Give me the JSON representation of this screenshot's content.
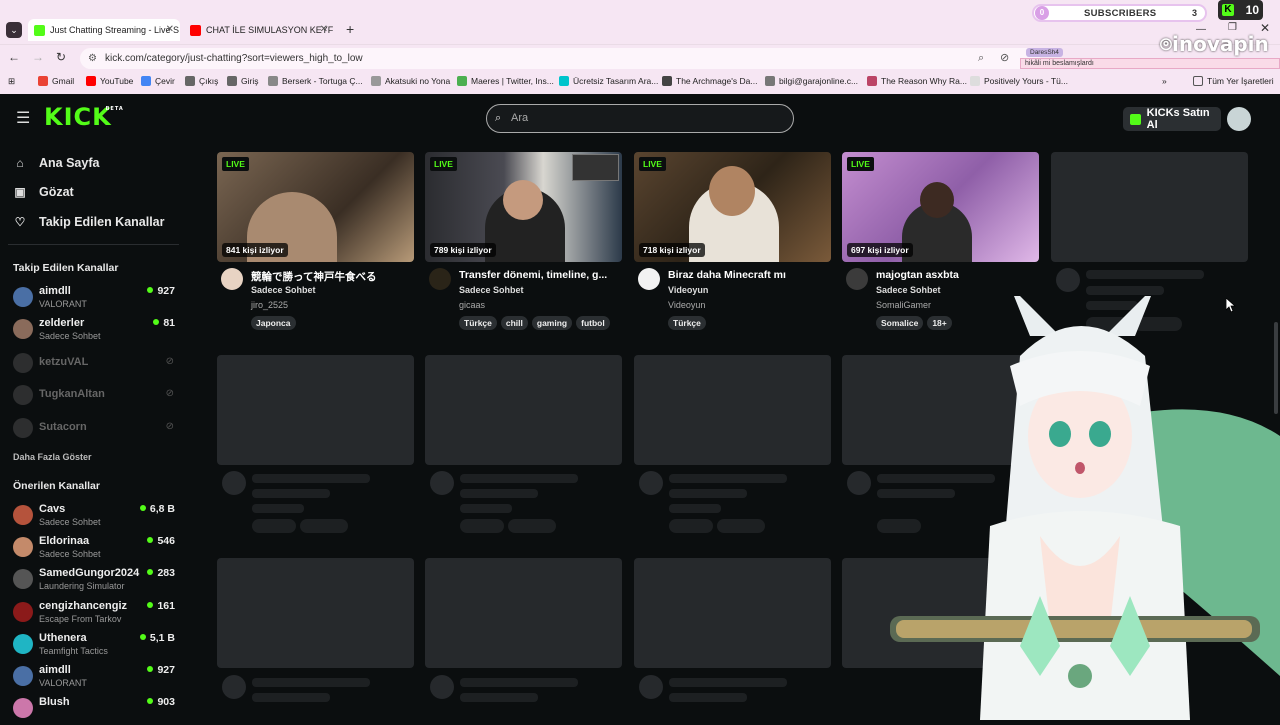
{
  "browser": {
    "tabs": [
      {
        "title": "Just Chatting Streaming - Live S",
        "active": true
      },
      {
        "title": "CHAT İLE SIMULASYON KEYFİ |",
        "active": false
      }
    ],
    "url": "kick.com/category/just-chatting?sort=viewers_high_to_low",
    "bookmarks": [
      "Gmail",
      "YouTube",
      "Çevir",
      "Çıkış",
      "Giriş",
      "Berserk - Tortuga Ç...",
      "Akatsuki no Yona",
      "Maeres | Twitter, Ins...",
      "Ücretsiz Tasarım Ara...",
      "The Archmage's Da...",
      "bilgi@garajonline.c...",
      "The Reason Why Ra...",
      "Positively Yours - Tü..."
    ],
    "all_bookmarks": "Tüm Yer İşaretleri"
  },
  "header": {
    "logo": "KICK",
    "logo_badge": "BETA",
    "search_placeholder": "Ara",
    "buy_button": "KICKs Satın Al"
  },
  "sidebar": {
    "nav": [
      {
        "label": "Ana Sayfa",
        "icon": "home-icon"
      },
      {
        "label": "Gözat",
        "icon": "browse-icon"
      },
      {
        "label": "Takip Edilen Kanallar",
        "icon": "heart-icon"
      }
    ],
    "followed_heading": "Takip Edilen Kanallar",
    "followed": [
      {
        "name": "aimdll",
        "sub": "VALORANT",
        "count": "927",
        "color": "#4a6fa5"
      },
      {
        "name": "zelderler",
        "sub": "Sadece Sohbet",
        "count": "81",
        "color": "#8a6b5b"
      }
    ],
    "offline": [
      "ketzuVAL",
      "TugkanAltan",
      "Sutacorn"
    ],
    "show_more": "Daha Fazla Göster",
    "recommended_heading": "Önerilen Kanallar",
    "recommended": [
      {
        "name": "Cavs",
        "sub": "Sadece Sohbet",
        "count": "6,8 B",
        "color": "#b5533c"
      },
      {
        "name": "Eldorinaa",
        "sub": "Sadece Sohbet",
        "count": "546",
        "color": "#c48a6a"
      },
      {
        "name": "SamedGungor2024",
        "sub": "Laundering Simulator",
        "count": "283",
        "color": "#555"
      },
      {
        "name": "cengizhancengiz",
        "sub": "Escape From Tarkov",
        "count": "161",
        "color": "#8b1a1a"
      },
      {
        "name": "Uthenera",
        "sub": "Teamfight Tactics",
        "count": "5,1 B",
        "color": "#1fb5c4"
      },
      {
        "name": "aimdll",
        "sub": "VALORANT",
        "count": "927",
        "color": "#4a6fa5"
      },
      {
        "name": "Blush",
        "sub": "",
        "count": "903",
        "color": "#c7a"
      }
    ]
  },
  "streams": [
    {
      "live": "LIVE",
      "viewers": "841 kişi izliyor",
      "title": "競輪で勝って神戸牛食べる",
      "category": "Sadece Sohbet",
      "user": "jiro_2525",
      "tags": [
        "Japonca"
      ],
      "avatar": "#e8d3c3",
      "thumb": "#6b5a4a"
    },
    {
      "live": "LIVE",
      "viewers": "789 kişi izliyor",
      "title": "Transfer dönemi, timeline, g...",
      "category": "Sadece Sohbet",
      "user": "gicaas",
      "tags": [
        "Türkçe",
        "chill",
        "gaming",
        "futbol"
      ],
      "avatar": "#2a2418",
      "thumb": "#3e3c40"
    },
    {
      "live": "LIVE",
      "viewers": "718 kişi izliyor",
      "title": "Biraz daha Minecraft mı",
      "category": "Videoyun",
      "user": "Videoyun",
      "tags": [
        "Türkçe"
      ],
      "avatar": "#f2f2f2",
      "thumb": "#4a3a2a"
    },
    {
      "live": "LIVE",
      "viewers": "697 kişi izliyor",
      "title": "majogtan asxbta",
      "category": "Sadece Sohbet",
      "user": "SomaliGamer",
      "tags": [
        "Somalice",
        "18+"
      ],
      "avatar": "#3b3b3b",
      "thumb": "#b07ab8"
    }
  ],
  "overlay": {
    "subs_label": "SUBSCRIBERS",
    "subs_left": "0",
    "subs_right": "3",
    "kick_count": "10",
    "brand": "inovapin",
    "chat_name": "DaresSh4",
    "chat_msg": "hikâli mi beslamışlardı"
  }
}
